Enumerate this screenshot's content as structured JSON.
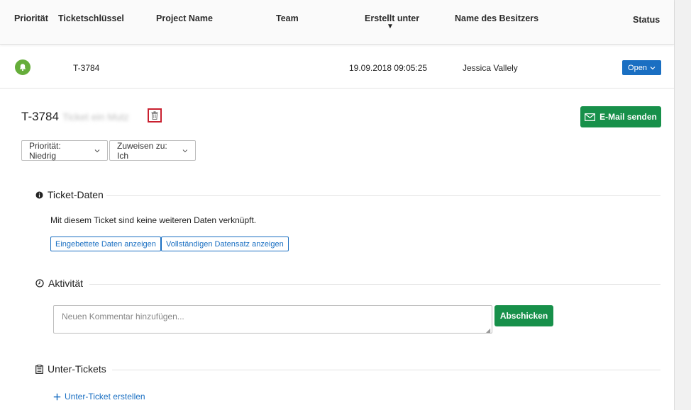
{
  "header": {
    "columns": {
      "priority": "Priorität",
      "ticket_key": "Ticketschlüssel",
      "project_name": "Project Name",
      "team": "Team",
      "created": "Erstellt unter",
      "owner": "Name des Besitzers",
      "status": "Status"
    },
    "sort_indicator": "▼"
  },
  "row": {
    "priority_icon": "bell-icon",
    "priority_color": "#65ad3a",
    "ticket_key": "T-3784",
    "project_name": "",
    "team": "",
    "created": "19.09.2018 09:05:25",
    "owner": "Jessica Vallely",
    "status_label": "Open"
  },
  "detail": {
    "ticket_id": "T-3784",
    "blurred_title": "Ticket ein Mutz",
    "delete_icon": "trash-icon",
    "email_button": "E-Mail senden",
    "priority_dropdown": "Priorität: Niedrig",
    "assign_dropdown": "Zuweisen zu: Ich"
  },
  "ticket_data": {
    "heading": "Ticket-Daten",
    "message": "Mit diesem Ticket sind keine weiteren Daten verknüpft.",
    "embedded_button": "Eingebettete Daten anzeigen",
    "full_record_button": "Vollständigen Datensatz anzeigen"
  },
  "activity": {
    "heading": "Aktivität",
    "comment_placeholder": "Neuen Kommentar hinzufügen...",
    "submit_button": "Abschicken"
  },
  "subtickets": {
    "heading": "Unter-Tickets",
    "create_link": "Unter-Ticket erstellen"
  },
  "colors": {
    "primary_blue": "#1a6fc2",
    "action_green": "#17904a",
    "highlight_red": "#c9202f"
  }
}
